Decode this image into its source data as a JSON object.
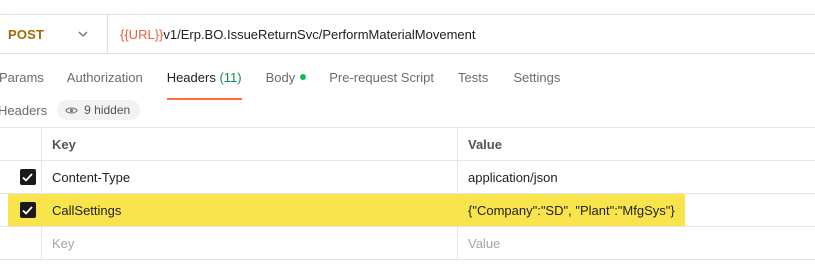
{
  "request": {
    "method": "POST",
    "url_variable": "{{URL}}",
    "url_path": "v1/Erp.BO.IssueReturnSvc/PerformMaterialMovement"
  },
  "tabs": [
    {
      "label": "Params"
    },
    {
      "label": "Authorization"
    },
    {
      "label": "Headers",
      "count": "(11)"
    },
    {
      "label": "Body"
    },
    {
      "label": "Pre-request Script"
    },
    {
      "label": "Tests"
    },
    {
      "label": "Settings"
    }
  ],
  "headers_section": {
    "title": "Headers",
    "hidden_label": "9 hidden"
  },
  "table": {
    "columns": {
      "key": "Key",
      "value": "Value"
    },
    "rows": [
      {
        "key": "Content-Type",
        "value": "application/json",
        "checked": true
      },
      {
        "key": "CallSettings",
        "value": "{\"Company\":\"SD\", \"Plant\":\"MfgSys\"}",
        "checked": true
      }
    ],
    "placeholder": {
      "key": "Key",
      "value": "Value"
    }
  },
  "colors": {
    "method": "#a36a00",
    "url_variable": "#e5603c",
    "active_tab_underline": "#ff6c37",
    "highlight": "#f9e44e",
    "body_dot": "#0cbb52"
  },
  "icons": {
    "method_dropdown": "chevron-down-icon",
    "hidden_headers": "eye-icon",
    "checkbox": "checkmark-icon"
  }
}
